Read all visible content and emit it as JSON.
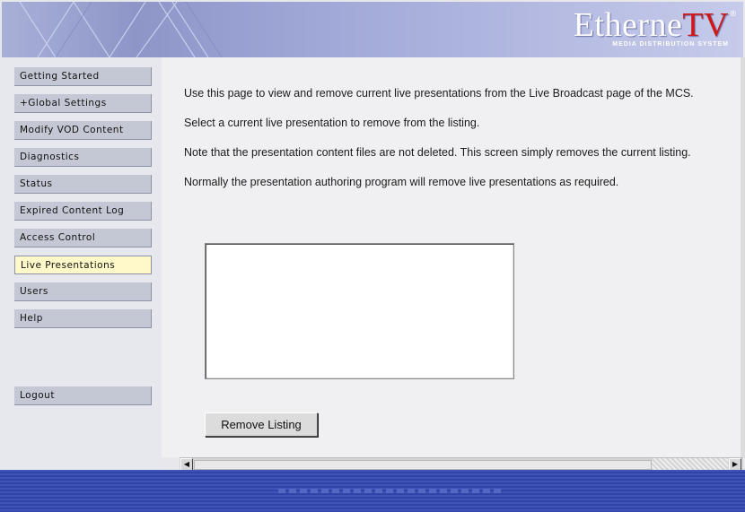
{
  "header": {
    "logo_word": "Etherne",
    "logo_tv": "TV",
    "logo_reg": "®",
    "logo_tagline": "MEDIA DISTRIBUTION SYSTEM"
  },
  "nav": {
    "items": [
      {
        "label": "Getting Started"
      },
      {
        "label": "+Global Settings"
      },
      {
        "label": "Modify VOD Content"
      },
      {
        "label": "Diagnostics"
      },
      {
        "label": "Status"
      },
      {
        "label": "Expired Content Log"
      },
      {
        "label": "Access Control"
      },
      {
        "label": "Live Presentations"
      },
      {
        "label": "Users"
      },
      {
        "label": "Help"
      }
    ],
    "active": "Live Presentations",
    "logout_label": "Logout"
  },
  "main": {
    "paragraphs": [
      "Use this page to view and remove current live presentations from the Live Broadcast page of the MCS.",
      "Select a current live presentation to remove from the listing.",
      "Note that the presentation content files are not deleted. This screen simply removes the current listing.",
      "Normally the presentation authoring program will remove live presentations as required."
    ],
    "remove_button_label": "Remove Listing"
  },
  "scrollbar": {
    "left_arrow": "◀",
    "right_arrow": "▶"
  },
  "colors": {
    "active_nav_bg": "#fff8c8",
    "nav_bg": "#c4c8d4",
    "footer_blue": "#3548ab",
    "logo_red": "#d01818"
  }
}
